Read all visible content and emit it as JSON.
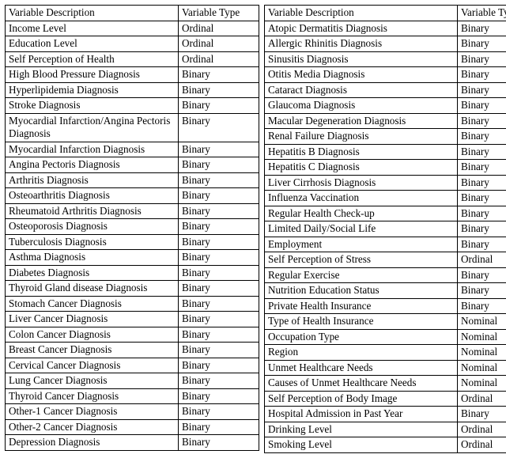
{
  "headers": {
    "description": "Variable Description",
    "type": "Variable Type"
  },
  "left_rows": [
    {
      "desc": "Income Level",
      "type": "Ordinal"
    },
    {
      "desc": "Education Level",
      "type": "Ordinal"
    },
    {
      "desc": "Self Perception of Health",
      "type": "Ordinal"
    },
    {
      "desc": "High Blood Pressure Diagnosis",
      "type": "Binary"
    },
    {
      "desc": "Hyperlipidemia Diagnosis",
      "type": "Binary"
    },
    {
      "desc": "Stroke Diagnosis",
      "type": "Binary"
    },
    {
      "desc": "Myocardial Infarction/Angina Pectoris Diagnosis",
      "type": "Binary"
    },
    {
      "desc": "Myocardial Infarction Diagnosis",
      "type": "Binary"
    },
    {
      "desc": "Angina Pectoris Diagnosis",
      "type": "Binary"
    },
    {
      "desc": "Arthritis Diagnosis",
      "type": "Binary"
    },
    {
      "desc": "Osteoarthritis Diagnosis",
      "type": "Binary"
    },
    {
      "desc": "Rheumatoid Arthritis Diagnosis",
      "type": "Binary"
    },
    {
      "desc": "Osteoporosis Diagnosis",
      "type": "Binary"
    },
    {
      "desc": "Tuberculosis Diagnosis",
      "type": "Binary"
    },
    {
      "desc": "Asthma Diagnosis",
      "type": "Binary"
    },
    {
      "desc": "Diabetes Diagnosis",
      "type": "Binary"
    },
    {
      "desc": "Thyroid Gland disease Diagnosis",
      "type": "Binary"
    },
    {
      "desc": "Stomach Cancer Diagnosis",
      "type": "Binary"
    },
    {
      "desc": "Liver Cancer Diagnosis",
      "type": "Binary"
    },
    {
      "desc": "Colon Cancer Diagnosis",
      "type": "Binary"
    },
    {
      "desc": "Breast Cancer Diagnosis",
      "type": "Binary"
    },
    {
      "desc": "Cervical Cancer Diagnosis",
      "type": "Binary"
    },
    {
      "desc": "Lung Cancer Diagnosis",
      "type": "Binary"
    },
    {
      "desc": "Thyroid Cancer Diagnosis",
      "type": "Binary"
    },
    {
      "desc": "Other-1 Cancer Diagnosis",
      "type": "Binary"
    },
    {
      "desc": "Other-2 Cancer Diagnosis",
      "type": "Binary"
    },
    {
      "desc": "Depression Diagnosis",
      "type": "Binary"
    }
  ],
  "right_rows": [
    {
      "desc": "Atopic Dermatitis Diagnosis",
      "type": "Binary"
    },
    {
      "desc": "Allergic Rhinitis Diagnosis",
      "type": "Binary"
    },
    {
      "desc": "Sinusitis Diagnosis",
      "type": "Binary"
    },
    {
      "desc": "Otitis Media Diagnosis",
      "type": "Binary"
    },
    {
      "desc": "Cataract Diagnosis",
      "type": "Binary"
    },
    {
      "desc": "Glaucoma Diagnosis",
      "type": "Binary"
    },
    {
      "desc": "Macular Degeneration Diagnosis",
      "type": "Binary"
    },
    {
      "desc": "Renal Failure Diagnosis",
      "type": "Binary"
    },
    {
      "desc": "Hepatitis B Diagnosis",
      "type": "Binary"
    },
    {
      "desc": "Hepatitis C Diagnosis",
      "type": "Binary"
    },
    {
      "desc": "Liver Cirrhosis Diagnosis",
      "type": "Binary"
    },
    {
      "desc": "Influenza Vaccination",
      "type": "Binary"
    },
    {
      "desc": "Regular Health Check-up",
      "type": "Binary"
    },
    {
      "desc": "Limited Daily/Social Life",
      "type": "Binary"
    },
    {
      "desc": "Employment",
      "type": "Binary"
    },
    {
      "desc": "Self Perception of Stress",
      "type": "Ordinal"
    },
    {
      "desc": "Regular Exercise",
      "type": "Binary"
    },
    {
      "desc": "Nutrition Education Status",
      "type": "Binary"
    },
    {
      "desc": "Private Health Insurance",
      "type": "Binary"
    },
    {
      "desc": "Type of Health Insurance",
      "type": "Nominal"
    },
    {
      "desc": "Occupation Type",
      "type": "Nominal"
    },
    {
      "desc": "Region",
      "type": "Nominal"
    },
    {
      "desc": "Unmet Healthcare Needs",
      "type": "Nominal"
    },
    {
      "desc": "Causes of Unmet Healthcare Needs",
      "type": "Nominal"
    },
    {
      "desc": "Self Perception of Body Image",
      "type": "Ordinal"
    },
    {
      "desc": "Hospital Admission in Past Year",
      "type": "Binary"
    },
    {
      "desc": "Drinking Level",
      "type": "Ordinal"
    },
    {
      "desc": "Smoking Level",
      "type": "Ordinal"
    }
  ]
}
